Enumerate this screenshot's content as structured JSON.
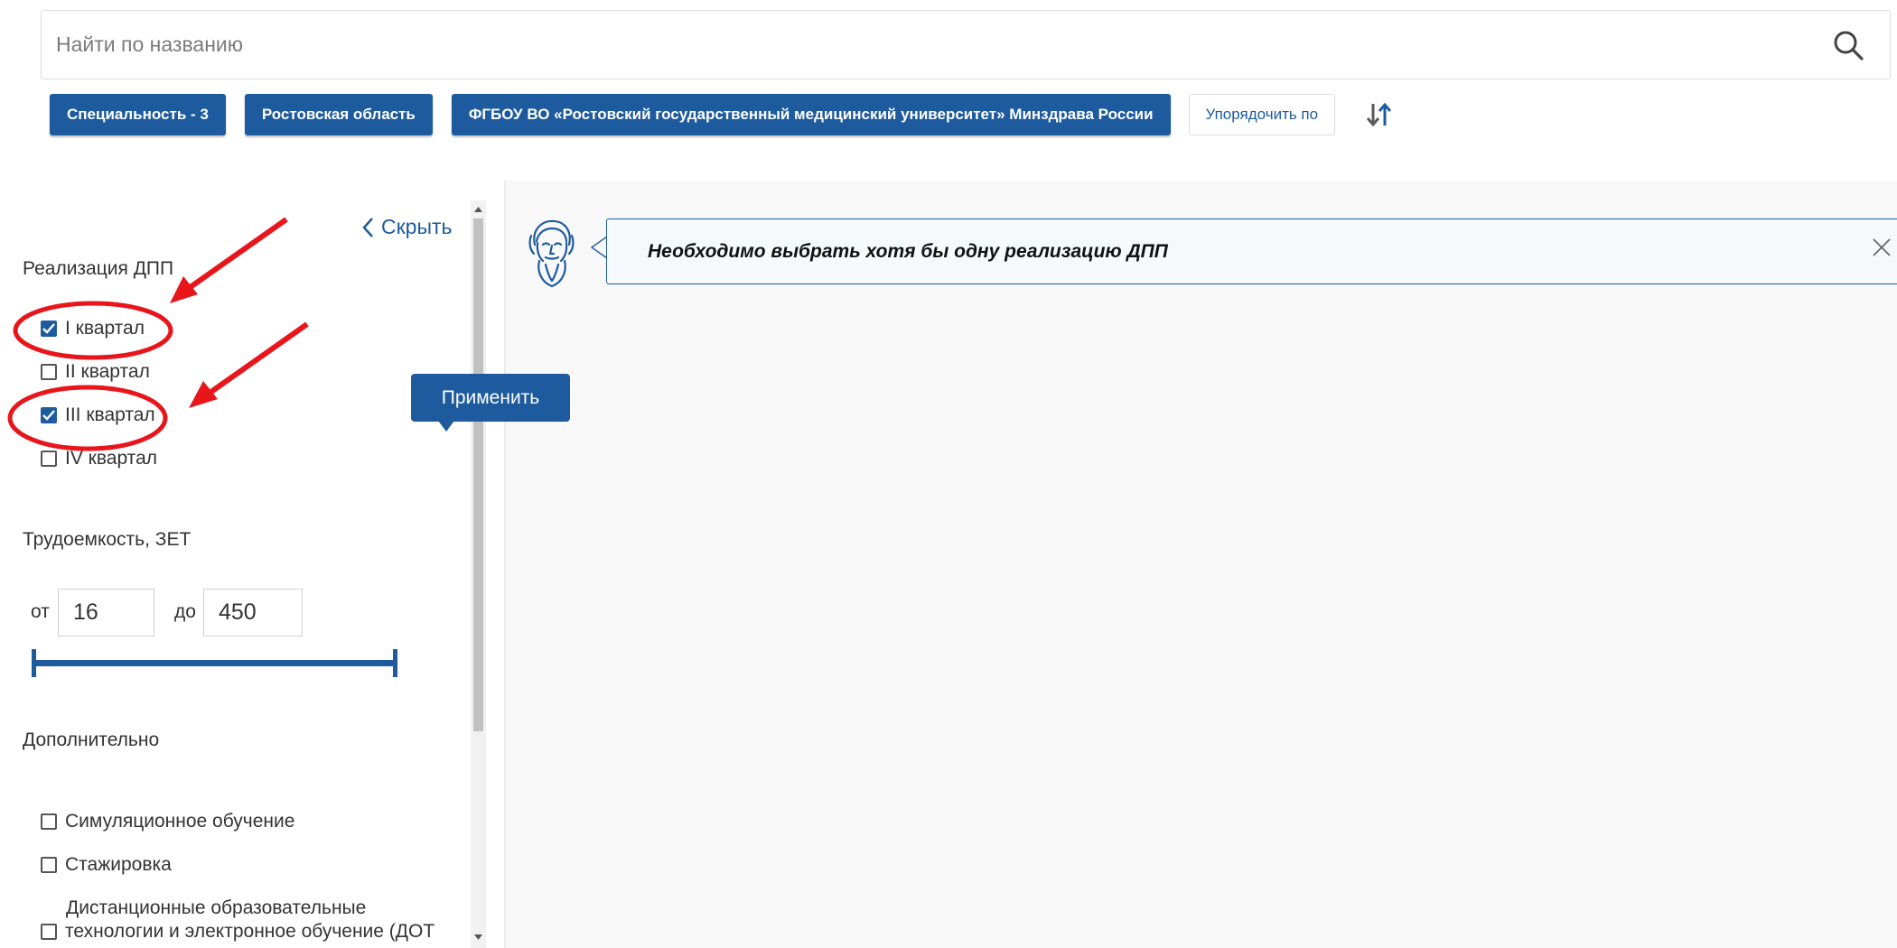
{
  "search": {
    "placeholder": "Найти по названию"
  },
  "chips": [
    {
      "label": "Специальность - 3"
    },
    {
      "label": "Ростовская область"
    },
    {
      "label": "ФГБОУ ВО «Ростовский государственный медицинский университет» Минздрава России"
    }
  ],
  "sort": {
    "label": "Упорядочить по"
  },
  "panel": {
    "hide_label": "Скрыть",
    "realization": {
      "title": "Реализация ДПП",
      "items": [
        {
          "label": "I квартал",
          "checked": true
        },
        {
          "label": "II квартал",
          "checked": false
        },
        {
          "label": "III квартал",
          "checked": true
        },
        {
          "label": "IV квартал",
          "checked": false
        }
      ]
    },
    "labor": {
      "title": "Трудоемкость, ЗЕТ",
      "from_label": "от",
      "from_value": "16",
      "to_label": "до",
      "to_value": "450"
    },
    "extra": {
      "title": "Дополнительно",
      "items": [
        {
          "label": "Симуляционное обучение",
          "checked": false
        },
        {
          "label": "Стажировка",
          "checked": false
        },
        {
          "label_line1": "Дистанционные образовательные",
          "label_line2": "технологии и электронное обучение (ДОТ",
          "checked": false
        }
      ]
    }
  },
  "apply_label": "Применить",
  "notice": {
    "text": "Необходимо выбрать хотя бы одну реализацию ДПП"
  },
  "colors": {
    "primary": "#1e5b9e",
    "annotation": "#e8151b"
  }
}
